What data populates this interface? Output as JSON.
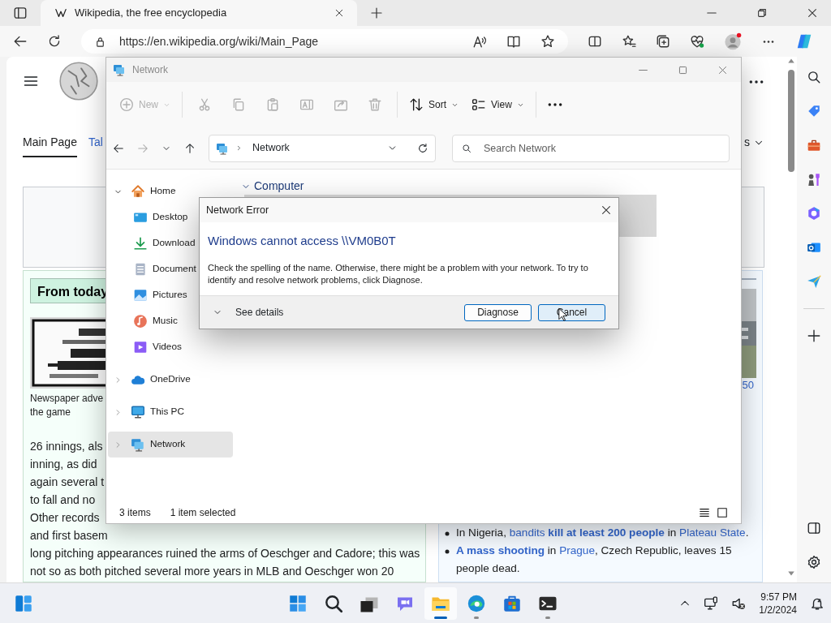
{
  "browser": {
    "tabs": [
      {
        "title": "Wikipedia, the free encyclopedia",
        "selected": true
      }
    ],
    "url": "https://en.wikipedia.org/wiki/Main_Page"
  },
  "wiki": {
    "nav_tabs": [
      {
        "label": "Main Page",
        "selected": true
      },
      {
        "label": "Tal",
        "selected": false
      }
    ],
    "nav_right": "s",
    "left_heading": "From today",
    "caption": [
      "Newspaper adve",
      "the game"
    ],
    "lines": [
      "26 innings, als",
      "inning, as did",
      "again several t",
      "to fall and no",
      "Other records",
      "and first basem",
      "long pitching appearances ruined the arms of Oeschger and Cadore; this was",
      "not so as both pitched several more years in MLB and Oeschger won 20"
    ],
    "right_caption": "50",
    "bullets": [
      {
        "segments": [
          {
            "text": "In Nigeria, "
          },
          {
            "text": "bandits",
            "link": true
          },
          {
            "text": " kill at least 200 people",
            "link": true,
            "bold": true
          },
          {
            "text": " in "
          },
          {
            "text": "Plateau State",
            "link": true
          },
          {
            "text": "."
          }
        ]
      },
      {
        "segments": [
          {
            "text": "A mass shooting",
            "link": true,
            "bold": true
          },
          {
            "text": " in "
          },
          {
            "text": "Prague",
            "link": true
          },
          {
            "text": ", Czech Republic, leaves 15 people dead."
          }
        ]
      }
    ]
  },
  "explorer": {
    "title": "Network",
    "toolbar": [
      {
        "label": "New",
        "disabled": true
      },
      {
        "disabled": true
      },
      {
        "disabled": true
      },
      {
        "disabled": true
      },
      {
        "disabled": true
      },
      {
        "disabled": true
      },
      {
        "disabled": true
      },
      {
        "label": "Sort",
        "disabled": false
      },
      {
        "label": "View",
        "disabled": false
      }
    ],
    "path": "Network",
    "search_placeholder": "Search Network",
    "nav": [
      {
        "label": "Home",
        "expanded": true,
        "selected": false,
        "children": [
          {
            "label": "Desktop",
            "selected": false
          },
          {
            "label": "Download",
            "selected": false
          },
          {
            "label": "Document",
            "selected": false
          },
          {
            "label": "Pictures",
            "selected": false
          },
          {
            "label": "Music",
            "selected": false
          },
          {
            "label": "Videos",
            "selected": false
          }
        ]
      },
      {
        "label": "OneDrive",
        "expanded": false,
        "selected": false
      },
      {
        "label": "This PC",
        "expanded": false,
        "selected": false
      },
      {
        "label": "Network",
        "expanded": false,
        "selected": true
      }
    ],
    "group": "Computer",
    "status": {
      "count": "3 items",
      "selection": "1 item selected"
    }
  },
  "dialog": {
    "title": "Network Error",
    "heading": "Windows cannot access \\\\VM0B0T",
    "message": "Check the spelling of the name. Otherwise, there might be a problem with your network. To try to identify and resolve network problems, click Diagnose.",
    "details": "See details",
    "buttons": [
      {
        "label": "Diagnose",
        "hovered": false
      },
      {
        "label": "Cancel",
        "hovered": true
      }
    ]
  },
  "taskbar": {
    "apps": [
      {
        "running": false,
        "active": false
      },
      {
        "running": false,
        "active": false
      },
      {
        "running": true,
        "active": true
      },
      {
        "running": true,
        "active": false
      },
      {
        "running": false,
        "active": false
      },
      {
        "running": true,
        "active": false
      }
    ],
    "time": "9:57 PM",
    "date": "1/2/2024"
  }
}
